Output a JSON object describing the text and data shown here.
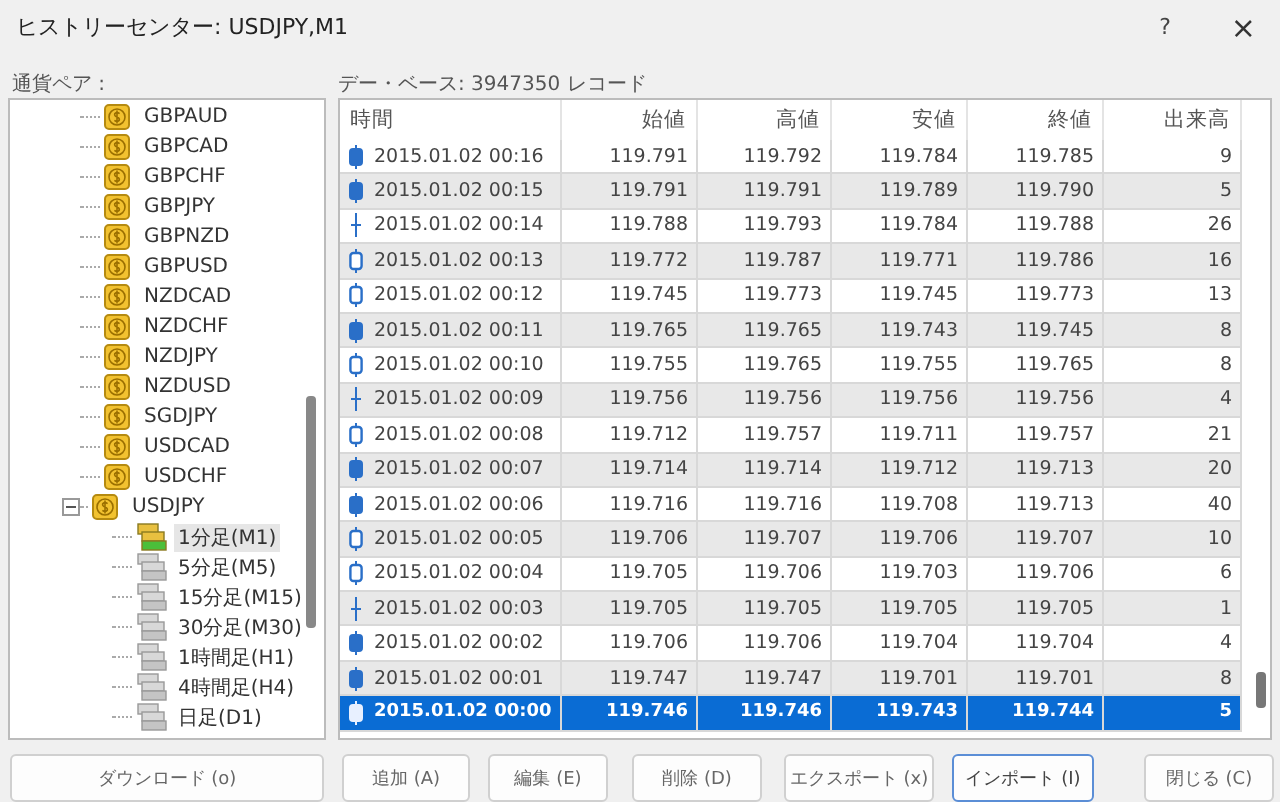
{
  "window": {
    "title": "ヒストリーセンター: USDJPY,M1",
    "help": "?",
    "close": "×"
  },
  "tree": {
    "label": "通貨ペア :",
    "items": [
      {
        "label": "GBPAUD",
        "expanded": false
      },
      {
        "label": "GBPCAD",
        "expanded": false
      },
      {
        "label": "GBPCHF",
        "expanded": false
      },
      {
        "label": "GBPJPY",
        "expanded": false
      },
      {
        "label": "GBPNZD",
        "expanded": false
      },
      {
        "label": "GBPUSD",
        "expanded": false
      },
      {
        "label": "NZDCAD",
        "expanded": false
      },
      {
        "label": "NZDCHF",
        "expanded": false
      },
      {
        "label": "NZDJPY",
        "expanded": false
      },
      {
        "label": "NZDUSD",
        "expanded": false
      },
      {
        "label": "SGDJPY",
        "expanded": false
      },
      {
        "label": "USDCAD",
        "expanded": false
      },
      {
        "label": "USDCHF",
        "expanded": false
      },
      {
        "label": "USDJPY",
        "expanded": true,
        "children": [
          {
            "label": "1分足(M1)",
            "selected": true
          },
          {
            "label": "5分足(M5)",
            "selected": false
          },
          {
            "label": "15分足(M15)",
            "selected": false
          },
          {
            "label": "30分足(M30)",
            "selected": false
          },
          {
            "label": "1時間足(H1)",
            "selected": false
          },
          {
            "label": "4時間足(H4)",
            "selected": false
          },
          {
            "label": "日足(D1)",
            "selected": false
          }
        ]
      }
    ]
  },
  "table": {
    "label": "デー・ベース: 3947350 レコード",
    "columns": [
      "時間",
      "始値",
      "高値",
      "安値",
      "終値",
      "出来高"
    ],
    "rows": [
      {
        "kind": "filled",
        "selected": false,
        "cells": [
          "2015.01.02 00:16",
          "119.791",
          "119.792",
          "119.784",
          "119.785",
          "9"
        ]
      },
      {
        "kind": "filled",
        "selected": false,
        "cells": [
          "2015.01.02 00:15",
          "119.791",
          "119.791",
          "119.789",
          "119.790",
          "5"
        ]
      },
      {
        "kind": "doji",
        "selected": false,
        "cells": [
          "2015.01.02 00:14",
          "119.788",
          "119.793",
          "119.784",
          "119.788",
          "26"
        ]
      },
      {
        "kind": "hollow",
        "selected": false,
        "cells": [
          "2015.01.02 00:13",
          "119.772",
          "119.787",
          "119.771",
          "119.786",
          "16"
        ]
      },
      {
        "kind": "hollow",
        "selected": false,
        "cells": [
          "2015.01.02 00:12",
          "119.745",
          "119.773",
          "119.745",
          "119.773",
          "13"
        ]
      },
      {
        "kind": "filled",
        "selected": false,
        "cells": [
          "2015.01.02 00:11",
          "119.765",
          "119.765",
          "119.743",
          "119.745",
          "8"
        ]
      },
      {
        "kind": "hollow",
        "selected": false,
        "cells": [
          "2015.01.02 00:10",
          "119.755",
          "119.765",
          "119.755",
          "119.765",
          "8"
        ]
      },
      {
        "kind": "doji",
        "selected": false,
        "cells": [
          "2015.01.02 00:09",
          "119.756",
          "119.756",
          "119.756",
          "119.756",
          "4"
        ]
      },
      {
        "kind": "hollow",
        "selected": false,
        "cells": [
          "2015.01.02 00:08",
          "119.712",
          "119.757",
          "119.711",
          "119.757",
          "21"
        ]
      },
      {
        "kind": "filled",
        "selected": false,
        "cells": [
          "2015.01.02 00:07",
          "119.714",
          "119.714",
          "119.712",
          "119.713",
          "20"
        ]
      },
      {
        "kind": "filled",
        "selected": false,
        "cells": [
          "2015.01.02 00:06",
          "119.716",
          "119.716",
          "119.708",
          "119.713",
          "40"
        ]
      },
      {
        "kind": "hollow",
        "selected": false,
        "cells": [
          "2015.01.02 00:05",
          "119.706",
          "119.707",
          "119.706",
          "119.707",
          "10"
        ]
      },
      {
        "kind": "hollow",
        "selected": false,
        "cells": [
          "2015.01.02 00:04",
          "119.705",
          "119.706",
          "119.703",
          "119.706",
          "6"
        ]
      },
      {
        "kind": "doji",
        "selected": false,
        "cells": [
          "2015.01.02 00:03",
          "119.705",
          "119.705",
          "119.705",
          "119.705",
          "1"
        ]
      },
      {
        "kind": "filled",
        "selected": false,
        "cells": [
          "2015.01.02 00:02",
          "119.706",
          "119.706",
          "119.704",
          "119.704",
          "4"
        ]
      },
      {
        "kind": "filled",
        "selected": false,
        "cells": [
          "2015.01.02 00:01",
          "119.747",
          "119.747",
          "119.701",
          "119.701",
          "8"
        ]
      },
      {
        "kind": "filled",
        "selected": true,
        "cells": [
          "2015.01.02 00:00",
          "119.746",
          "119.746",
          "119.743",
          "119.744",
          "5"
        ]
      }
    ]
  },
  "buttons": [
    {
      "label": "ダウンロード (o)",
      "focused": false
    },
    {
      "label": "追加 (A)",
      "focused": false
    },
    {
      "label": "編集 (E)",
      "focused": false
    },
    {
      "label": "削除 (D)",
      "focused": false
    },
    {
      "label": "エクスポート (x)",
      "focused": false
    },
    {
      "label": "インポート (I)",
      "focused": true
    },
    {
      "label": "閉じる (C)",
      "focused": false
    }
  ]
}
